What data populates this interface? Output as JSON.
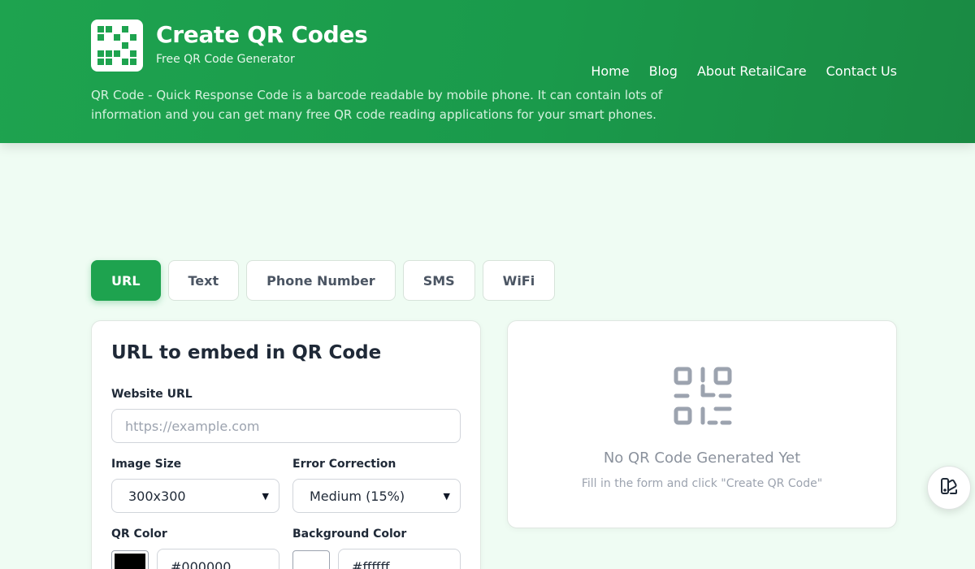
{
  "header": {
    "title": "Create QR Codes",
    "subtitle": "Free QR Code Generator",
    "intro": "QR Code - Quick Response Code is a barcode readable by mobile phone. It can contain lots of information and you can get many free QR code reading applications for your smart phones.",
    "nav": [
      "Home",
      "Blog",
      "About RetailCare",
      "Contact Us"
    ]
  },
  "tabs": [
    "URL",
    "Text",
    "Phone Number",
    "SMS",
    "WiFi"
  ],
  "active_tab": "URL",
  "form": {
    "title": "URL to embed in QR Code",
    "url_label": "Website URL",
    "url_placeholder": "https://example.com",
    "size_label": "Image Size",
    "size_value": "300x300",
    "ec_label": "Error Correction",
    "ec_value": "Medium (15%)",
    "qr_color_label": "QR Color",
    "qr_color_value": "#000000",
    "bg_color_label": "Background Color",
    "bg_color_value": "#ffffff"
  },
  "preview": {
    "title": "No QR Code Generated Yet",
    "subtitle": "Fill in the form and click \"Create QR Code\""
  },
  "icons": {
    "logo": "qr-logo-icon",
    "preview": "qr-placeholder-icon",
    "fab": "theme-palette-icon",
    "select": "chevron-down-icon"
  },
  "colors": {
    "brand_green": "#1ea34f",
    "page_background": "#effcf3",
    "muted_icon": "#9ca3af"
  }
}
